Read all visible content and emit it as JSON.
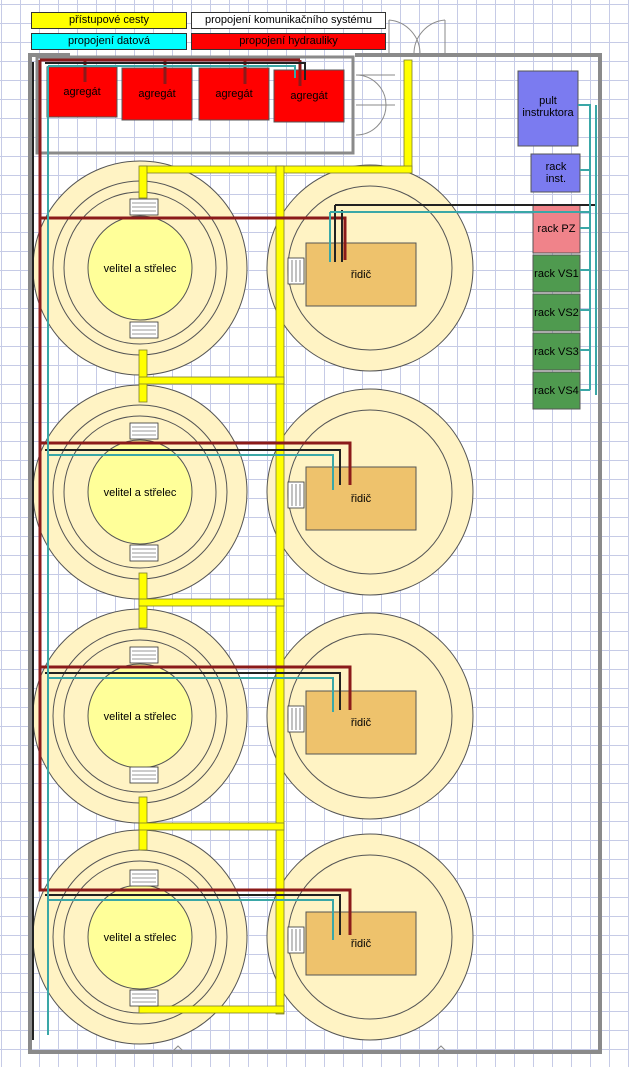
{
  "legend": {
    "pristupove_cesty": "přístupové cesty",
    "propojeni_komunikacniho_systemu": "propojení komunikačního systému",
    "propojeni_datova": "propojení datová",
    "propojeni_hydrauliky": "propojení hydrauliky"
  },
  "colors": {
    "access_path": "#ffff00",
    "comm_link": "#ffffff",
    "data_link": "#00ffff",
    "hydraulics": "#ff0000",
    "platform_outer": "#fff3c4",
    "platform_inner": "#ffff99",
    "driver_box": "#eec26c",
    "instructor": "#7b7bf0",
    "rack_pz": "#f0838a",
    "rack_vs": "#4f9a4f"
  },
  "aggregates": [
    "agregát",
    "agregát",
    "agregát",
    "agregát"
  ],
  "stations": [
    {
      "commander": "velitel a střelec",
      "driver": "řidič"
    },
    {
      "commander": "velitel a střelec",
      "driver": "řidič"
    },
    {
      "commander": "velitel a střelec",
      "driver": "řidič"
    },
    {
      "commander": "velitel a střelec",
      "driver": "řidič"
    }
  ],
  "equipment": {
    "instructor_console": "pult instruktora",
    "rack_inst": "rack inst.",
    "rack_pz": "rack PZ",
    "rack_vs": [
      "rack VS1",
      "rack VS2",
      "rack VS3",
      "rack VS4"
    ]
  }
}
